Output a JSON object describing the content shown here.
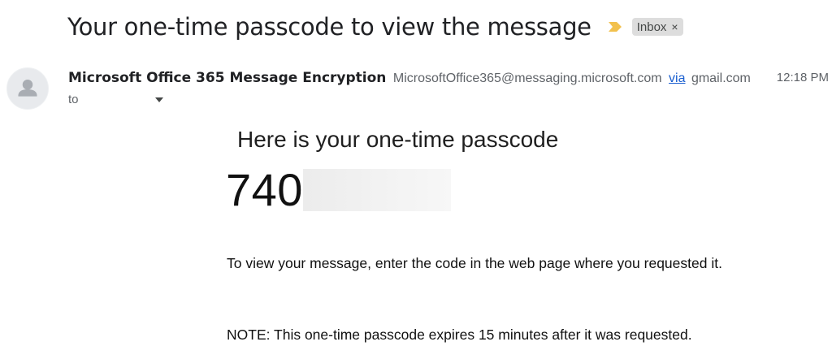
{
  "email": {
    "subject": "Your one-time passcode to view the message",
    "label": "Inbox",
    "label_close": "×",
    "sender": {
      "name": "Microsoft Office 365 Message Encryption",
      "email": "MicrosoftOffice365@messaging.microsoft.com",
      "via_label": "via",
      "via_domain": "gmail.com"
    },
    "timestamp": "12:18 PM",
    "to_label": "to"
  },
  "body": {
    "heading": "Here is your one-time passcode",
    "code_visible": "740",
    "instruction": "To view your message, enter the code in the web page where you requested it.",
    "note": "NOTE: This one-time passcode expires 15 minutes after it was requested."
  },
  "icons": {
    "importance": "importance-marker-icon",
    "avatar": "default-avatar-icon",
    "dropdown": "chevron-down-icon"
  },
  "colors": {
    "importance_marker": "#f2c14e",
    "label_chip_bg": "#dddddd",
    "link": "#1a5fd0"
  }
}
